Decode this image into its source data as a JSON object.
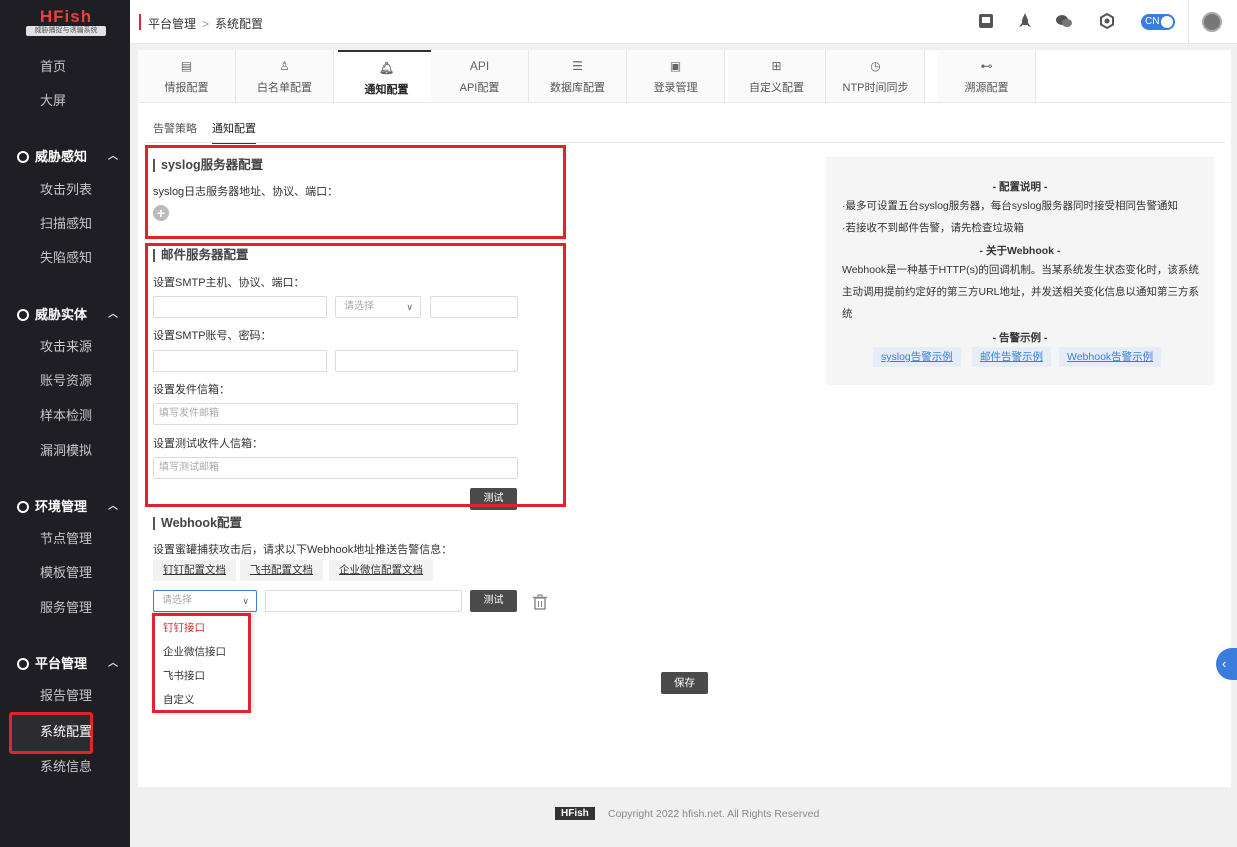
{
  "sidebar": {
    "logo": {
      "main": "HFish",
      "sub": "威胁捕捉与诱骗系统"
    },
    "top_items": [
      "首页",
      "大屏"
    ],
    "groups": [
      {
        "title": "威胁感知",
        "icon": "radar-icon",
        "items": [
          "攻击列表",
          "扫描感知",
          "失陷感知"
        ]
      },
      {
        "title": "威胁实体",
        "icon": "shield-icon",
        "items": [
          "攻击来源",
          "账号资源",
          "样本检测",
          "漏洞模拟"
        ]
      },
      {
        "title": "环境管理",
        "icon": "settings-icon",
        "items": [
          "节点管理",
          "模板管理",
          "服务管理"
        ]
      },
      {
        "title": "平台管理",
        "icon": "gear-icon",
        "items": [
          "报告管理",
          "系统配置",
          "系统信息"
        ]
      }
    ],
    "active_item": "系统配置"
  },
  "header": {
    "breadcrumb": [
      "平台管理",
      "系统配置"
    ],
    "icons": [
      "document-icon",
      "rocket-icon",
      "wechat-icon",
      "hexagon-icon"
    ],
    "lang": "CN"
  },
  "tabs": [
    {
      "label": "情报配置",
      "icon": "document-icon",
      "icon_text": ""
    },
    {
      "label": "白名单配置",
      "icon": "user-icon",
      "icon_text": ""
    },
    {
      "label": "通知配置",
      "icon": "bell-icon",
      "icon_text": "",
      "active": true
    },
    {
      "label": "API配置",
      "icon": "api-icon",
      "icon_text": "API"
    },
    {
      "label": "数据库配置",
      "icon": "database-icon",
      "icon_text": ""
    },
    {
      "label": "登录管理",
      "icon": "monitor-icon",
      "icon_text": ""
    },
    {
      "label": "自定义配置",
      "icon": "grid-icon",
      "icon_text": ""
    },
    {
      "label": "NTP时间同步",
      "icon": "clock-icon",
      "icon_text": ""
    },
    {
      "label": "溯源配置",
      "icon": "network-icon",
      "icon_text": ""
    }
  ],
  "subtabs": [
    "告警策略",
    "通知配置"
  ],
  "syslog": {
    "title": "syslog服务器配置",
    "label": "syslog日志服务器地址、协议、端口："
  },
  "mail": {
    "title": "邮件服务器配置",
    "smtp_label": "设置SMTP主机、协议、端口：",
    "protocol_placeholder": "请选择",
    "account_label": "设置SMTP账号、密码：",
    "sender_label": "设置发件信箱：",
    "sender_placeholder": "填写发件邮箱",
    "test_receiver_label": "设置测试收件人信箱：",
    "test_receiver_placeholder": "填写测试邮箱",
    "test_button": "测试"
  },
  "webhook": {
    "title": "Webhook配置",
    "desc": "设置蜜罐捕获攻击后，请求以下Webhook地址推送告警信息：",
    "docs": [
      "钉钉配置文档",
      "飞书配置文档",
      "企业微信配置文档"
    ],
    "select_placeholder": "请选择",
    "test_button": "测试",
    "dropdown_options": [
      "钉钉接口",
      "企业微信接口",
      "飞书接口",
      "自定义"
    ]
  },
  "info": {
    "h1": "- 配置说明 -",
    "p1": "·最多可设置五台syslog服务器，每台syslog服务器同时接受相同告警通知",
    "p2": "·若接收不到邮件告警，请先检查垃圾箱",
    "h2": "- 关于Webhook -",
    "p3": "Webhook是一种基于HTTP(s)的回调机制。当某系统发生状态变化时，该系统主动调用提前约定好的第三方URL地址，并发送相关变化信息以通知第三方系统",
    "h3": "- 告警示例 -",
    "links": [
      "syslog告警示例",
      "邮件告警示例",
      "Webhook告警示例"
    ]
  },
  "save_button": "保存",
  "footer": {
    "badge": "HFish",
    "text": "Copyright 2022 hfish.net. All Rights Reserved"
  }
}
